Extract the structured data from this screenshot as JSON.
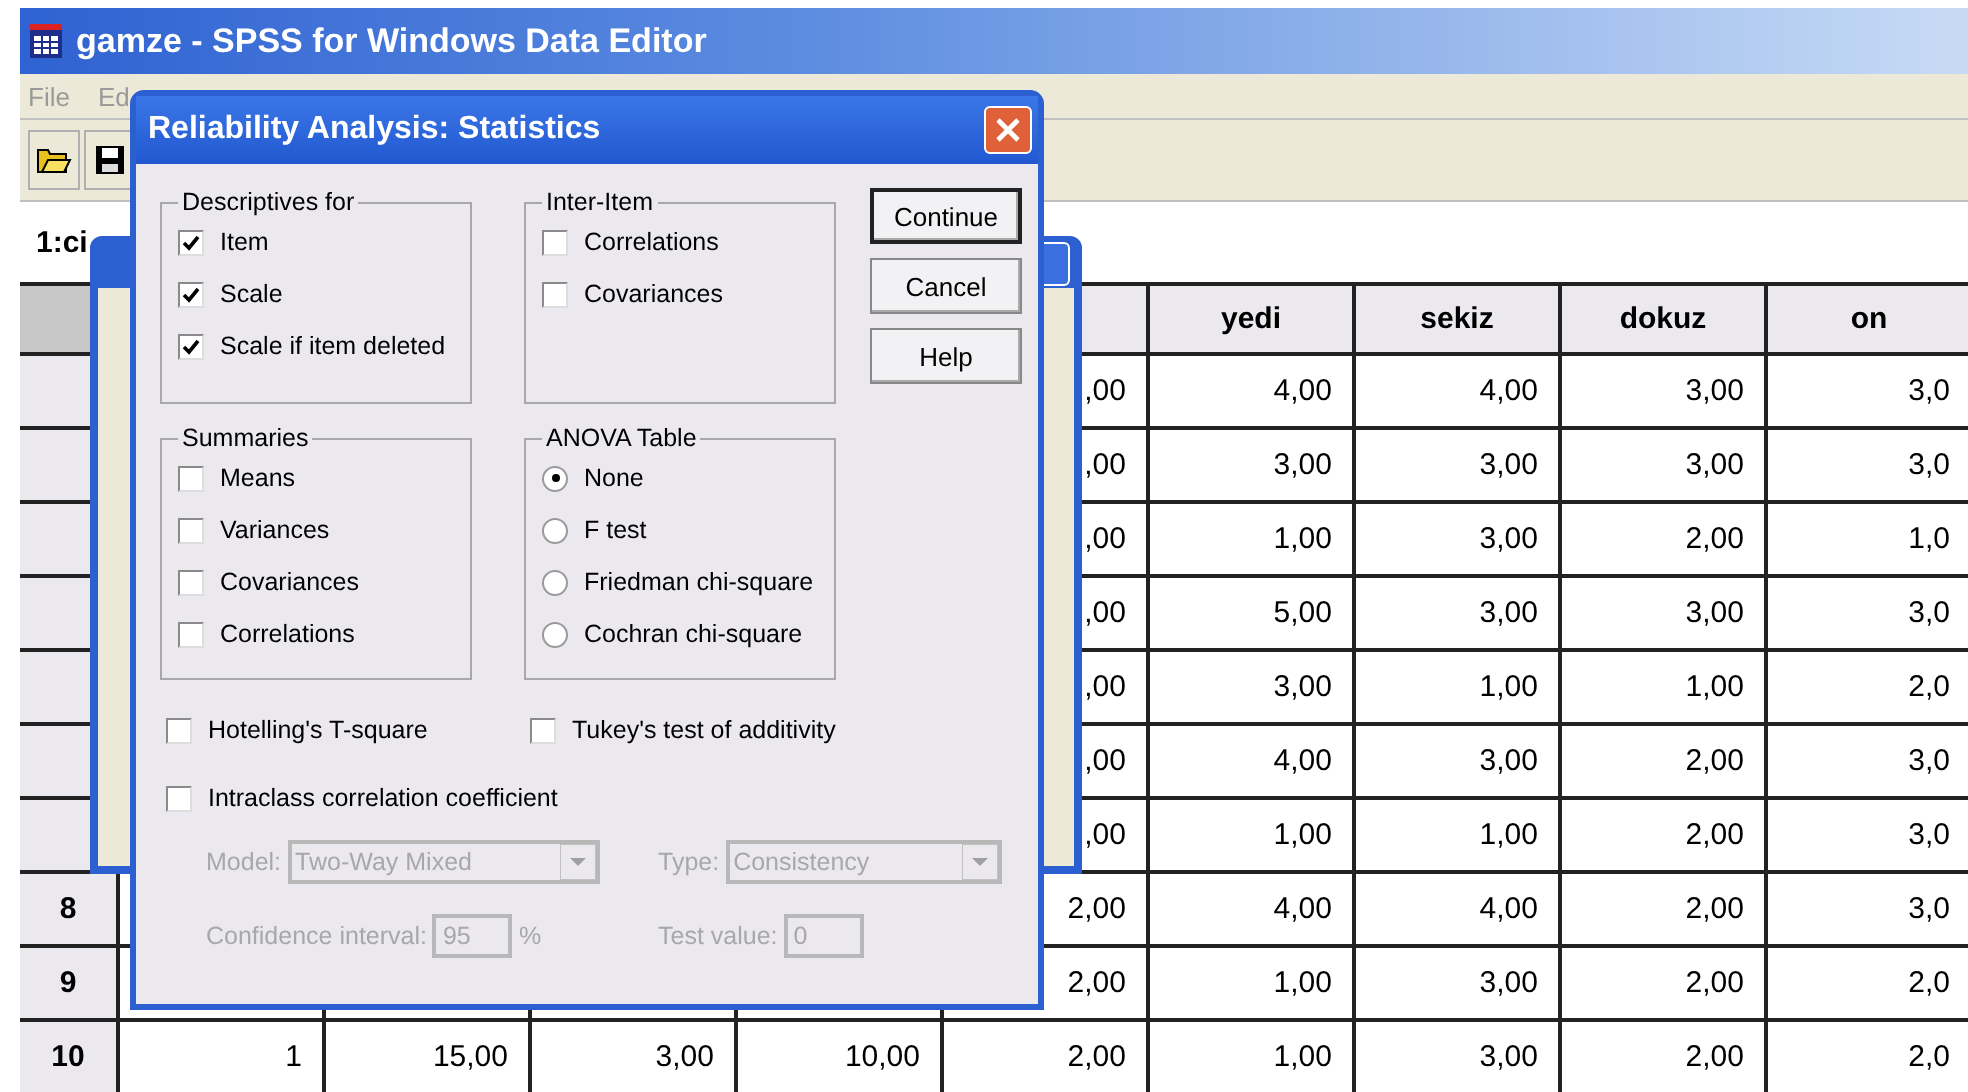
{
  "window": {
    "title": "gamze - SPSS for Windows Data Editor"
  },
  "menu": [
    "File",
    "Ed"
  ],
  "cell_editor": {
    "label": "1:ci"
  },
  "table": {
    "columns": [
      "",
      "yedi",
      "sekiz",
      "dokuz",
      "on"
    ],
    "rows": [
      {
        "cells": [
          "",
          "",
          "",
          "",
          ",00",
          "4,00",
          "4,00",
          "3,00",
          "3,0"
        ]
      },
      {
        "cells": [
          "",
          "",
          "",
          "",
          ",00",
          "3,00",
          "3,00",
          "3,00",
          "3,0"
        ]
      },
      {
        "cells": [
          "",
          "",
          "",
          "",
          ",00",
          "1,00",
          "3,00",
          "2,00",
          "1,0"
        ]
      },
      {
        "cells": [
          "",
          "",
          "",
          "",
          ",00",
          "5,00",
          "3,00",
          "3,00",
          "3,0"
        ]
      },
      {
        "cells": [
          "",
          "",
          "",
          "",
          ",00",
          "3,00",
          "1,00",
          "1,00",
          "2,0"
        ]
      },
      {
        "cells": [
          "",
          "",
          "",
          "",
          ",00",
          "4,00",
          "3,00",
          "2,00",
          "3,0"
        ]
      },
      {
        "cells": [
          "",
          "",
          "",
          "",
          ",00",
          "1,00",
          "1,00",
          "2,00",
          "3,0"
        ]
      },
      {
        "header": "8",
        "cells": [
          "",
          "",
          "",
          "",
          "2,00",
          "4,00",
          "4,00",
          "2,00",
          "3,0"
        ]
      },
      {
        "header": "9",
        "cells": [
          "",
          "",
          "",
          "",
          "2,00",
          "1,00",
          "3,00",
          "2,00",
          "2,0"
        ]
      },
      {
        "header": "10",
        "cells": [
          "1",
          "15,00",
          "3,00",
          "10,00",
          "2,00",
          "1,00",
          "3,00",
          "2,00",
          "2,0"
        ]
      }
    ]
  },
  "dialog": {
    "title": "Reliability Analysis: Statistics",
    "groups": [
      {
        "title": "Descriptives for",
        "items": [
          {
            "kind": "checkbox",
            "label": "Item",
            "checked": true
          },
          {
            "kind": "checkbox",
            "label": "Scale",
            "checked": true
          },
          {
            "kind": "checkbox",
            "label": "Scale if item deleted",
            "checked": true
          }
        ]
      },
      {
        "title": "Inter-Item",
        "items": [
          {
            "kind": "checkbox",
            "label": "Correlations",
            "checked": false
          },
          {
            "kind": "checkbox",
            "label": "Covariances",
            "checked": false
          }
        ]
      },
      {
        "title": "Summaries",
        "items": [
          {
            "kind": "checkbox",
            "label": "Means",
            "checked": false
          },
          {
            "kind": "checkbox",
            "label": "Variances",
            "checked": false
          },
          {
            "kind": "checkbox",
            "label": "Covariances",
            "checked": false
          },
          {
            "kind": "checkbox",
            "label": "Correlations",
            "checked": false
          }
        ]
      },
      {
        "title": "ANOVA Table",
        "items": [
          {
            "kind": "radio",
            "label": "None",
            "selected": true
          },
          {
            "kind": "radio",
            "label": "F test",
            "selected": false
          },
          {
            "kind": "radio",
            "label": "Friedman chi-square",
            "selected": false
          },
          {
            "kind": "radio",
            "label": "Cochran chi-square",
            "selected": false
          }
        ]
      }
    ],
    "buttons": [
      {
        "label": "Continue",
        "default": true
      },
      {
        "label": "Cancel",
        "default": false
      },
      {
        "label": "Help",
        "default": false
      }
    ],
    "options": [
      {
        "label": "Hotelling's T-square",
        "checked": false
      },
      {
        "label": "Tukey's test of additivity",
        "checked": false
      }
    ],
    "intraclass": {
      "label": "Intraclass correlation coefficient",
      "checked": false,
      "fields": [
        {
          "kind": "select",
          "label": "Model:",
          "value": "Two-Way Mixed",
          "disabled": true
        },
        {
          "kind": "select",
          "label": "Type:",
          "value": "Consistency",
          "disabled": true
        },
        {
          "kind": "input",
          "label": "Confidence interval:",
          "value": "95",
          "suffix": "%",
          "disabled": true
        },
        {
          "kind": "input",
          "label": "Test value:",
          "value": "0",
          "disabled": true
        }
      ]
    }
  }
}
